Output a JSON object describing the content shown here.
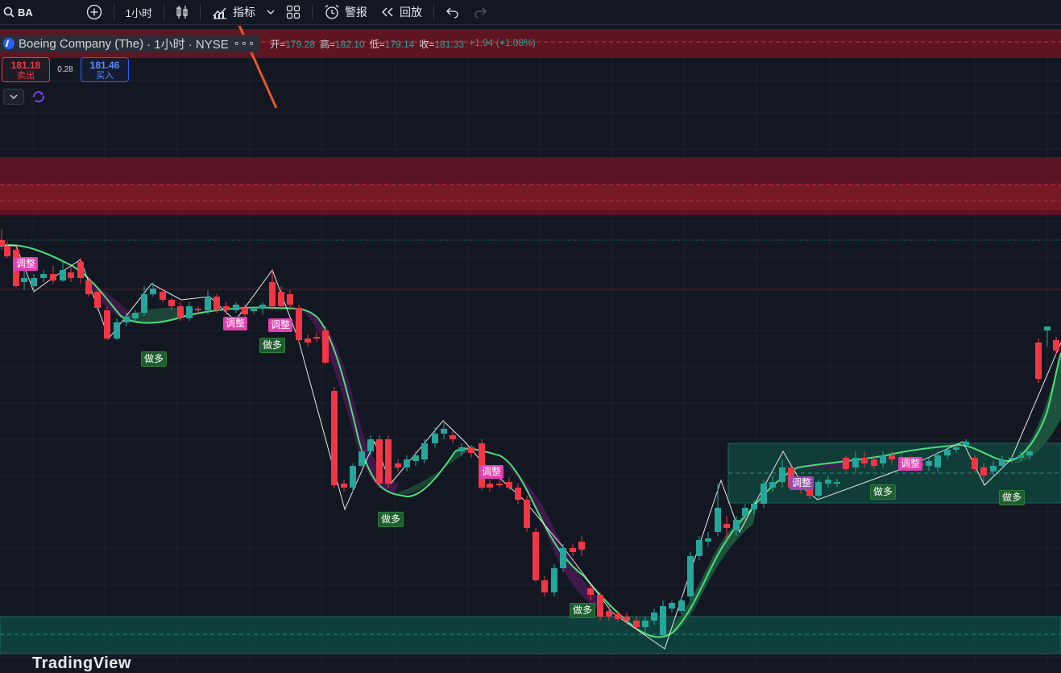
{
  "toolbar": {
    "symbol": "BA",
    "interval": "1小时",
    "indicators_label": "指标",
    "alert_label": "警报",
    "replay_label": "回放"
  },
  "legend": {
    "title": "Boeing Company (The)",
    "meta": "· 1小时 · NYSE",
    "more": "∘∘∘",
    "open_label": "开=",
    "open_value": "179.28",
    "high_label": "高=",
    "high_value": "182.10",
    "low_label": "低=",
    "low_value": "179.14",
    "close_label": "收=",
    "close_value": "181.33",
    "change": "+1.94 (+1.08%)"
  },
  "trade": {
    "sell_price": "181.18",
    "sell_label": "卖出",
    "spread": "0.28",
    "buy_price": "181.46",
    "buy_label": "买入"
  },
  "signals": {
    "adjust": "调整",
    "long": "做多"
  },
  "watermark": "TradingView",
  "colors": {
    "background": "#131722",
    "up": "#26a69a",
    "down": "#f23645",
    "adjust_label": "#e040b0",
    "long_label": "#1e5e2e",
    "resistance_zone": "#7a1622",
    "support_zone": "#0f4a40",
    "trend_line": "#4cdd7a"
  },
  "icons": [
    "search-icon",
    "add-symbol-icon",
    "candles-icon",
    "indicators-icon",
    "chevron-down-icon",
    "layout-grid-icon",
    "alert-clock-icon",
    "replay-icon",
    "undo-icon",
    "redo-icon",
    "collapse-chevron-icon",
    "sync-icon",
    "arrow-annotation"
  ]
}
